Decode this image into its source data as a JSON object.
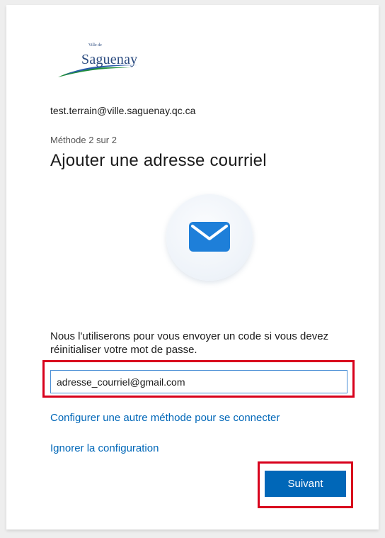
{
  "logo": {
    "small_text": "Ville de",
    "name": "Saguenay"
  },
  "account": {
    "email": "test.terrain@ville.saguenay.qc.ca"
  },
  "step": {
    "method_label": "Méthode 2 sur 2",
    "title": "Ajouter une adresse courriel"
  },
  "illustration": {
    "icon": "envelope-icon",
    "color": "#1e7fd9"
  },
  "form": {
    "description": "Nous l'utiliserons pour vous envoyer un code si vous devez réinitialiser votre mot de passe.",
    "email_value": "adresse_courriel@gmail.com"
  },
  "links": {
    "other_method": "Configurer une autre méthode pour se connecter",
    "skip": "Ignorer la configuration"
  },
  "buttons": {
    "next": "Suivant"
  },
  "colors": {
    "accent": "#0067b8",
    "highlight": "#d8001c"
  }
}
